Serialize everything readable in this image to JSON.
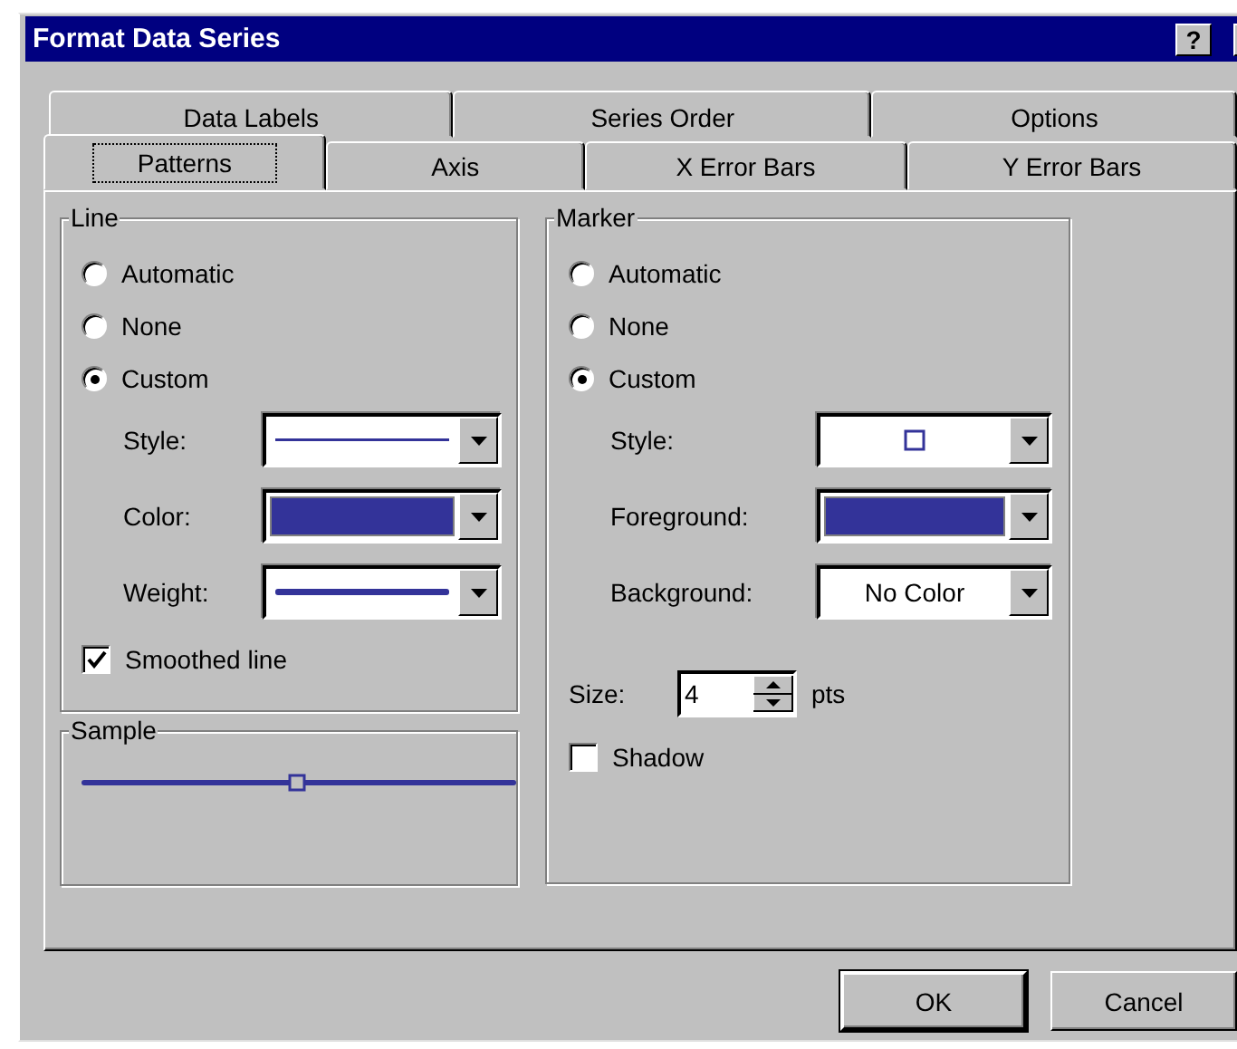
{
  "window": {
    "title": "Format Data Series",
    "title_buttons": [
      "?"
    ]
  },
  "tabs_back": [
    {
      "label": "Data Labels",
      "selected": false
    },
    {
      "label": "Series Order",
      "selected": false
    },
    {
      "label": "Options",
      "selected": false
    }
  ],
  "tabs_front": [
    {
      "label": "Patterns",
      "selected": true
    },
    {
      "label": "Axis",
      "selected": false
    },
    {
      "label": "X Error Bars",
      "selected": false
    },
    {
      "label": "Y Error Bars",
      "selected": false
    }
  ],
  "line": {
    "title": "Line",
    "options": [
      {
        "label": "Automatic",
        "selected": false
      },
      {
        "label": "None",
        "selected": false
      },
      {
        "label": "Custom",
        "selected": true
      }
    ],
    "fields": [
      {
        "label": "Style:",
        "kind": "thin-line"
      },
      {
        "label": "Color:",
        "kind": "swatch",
        "color": "#333399"
      },
      {
        "label": "Weight:",
        "kind": "thick-line"
      }
    ],
    "smoothed": {
      "label": "Smoothed line",
      "checked": true
    }
  },
  "sample": {
    "title": "Sample"
  },
  "marker": {
    "title": "Marker",
    "options": [
      {
        "label": "Automatic",
        "selected": false
      },
      {
        "label": "None",
        "selected": false
      },
      {
        "label": "Custom",
        "selected": true
      }
    ],
    "fields": [
      {
        "label": "Style:",
        "kind": "square"
      },
      {
        "label": "Foreground:",
        "kind": "swatch",
        "color": "#333399"
      },
      {
        "label": "Background:",
        "kind": "text",
        "value": "No Color"
      }
    ],
    "size": {
      "label": "Size:",
      "value": "4",
      "unit": "pts"
    },
    "shadow": {
      "label": "Shadow",
      "checked": false
    }
  },
  "buttons": [
    {
      "label": "OK",
      "default": true
    },
    {
      "label": "Cancel",
      "default": false
    }
  ]
}
